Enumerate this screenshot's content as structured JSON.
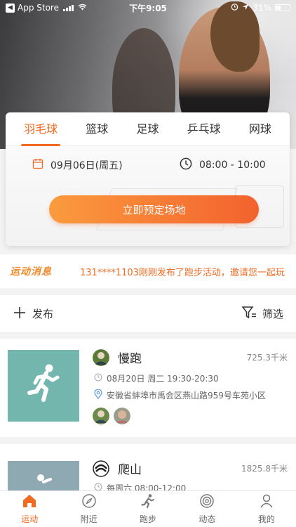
{
  "status_bar": {
    "back_app": "App Store",
    "time": "下午9:05",
    "battery": "31%"
  },
  "booking": {
    "tabs": [
      {
        "label": "羽毛球",
        "active": true
      },
      {
        "label": "篮球",
        "active": false
      },
      {
        "label": "足球",
        "active": false
      },
      {
        "label": "乒乓球",
        "active": false
      },
      {
        "label": "网球",
        "active": false
      }
    ],
    "date": "09月06日(周五)",
    "time_range": "08:00 - 10:00",
    "book_button": "立即预定场地",
    "icons": {
      "date": "calendar-icon",
      "time": "clock-icon"
    }
  },
  "news": {
    "logo": "运动消息",
    "message": "131****1103刚刚发布了跑步活动，邀请您一起玩"
  },
  "toolbar": {
    "publish": "发布",
    "filter": "筛选"
  },
  "activities": [
    {
      "title": "慢跑",
      "distance": "725.3千米",
      "time": "08月20日 周二 19:30-20:30",
      "address": "安徽省蚌埠市禹会区燕山路959号车苑小区",
      "thumb_color": "#73b6ae"
    },
    {
      "title": "爬山",
      "distance": "1825.8千米",
      "time": "每周六 08:00-12:00",
      "thumb_color": "#8fa9b3"
    }
  ],
  "tabbar": [
    {
      "label": "运动",
      "icon": "home-icon",
      "active": true
    },
    {
      "label": "附近",
      "icon": "compass-icon",
      "active": false
    },
    {
      "label": "跑步",
      "icon": "runner-icon",
      "active": false
    },
    {
      "label": "动态",
      "icon": "radar-icon",
      "active": false
    },
    {
      "label": "我的",
      "icon": "user-icon",
      "active": false
    }
  ],
  "colors": {
    "accent": "#f26b22",
    "thumb_teal": "#73b6ae"
  }
}
